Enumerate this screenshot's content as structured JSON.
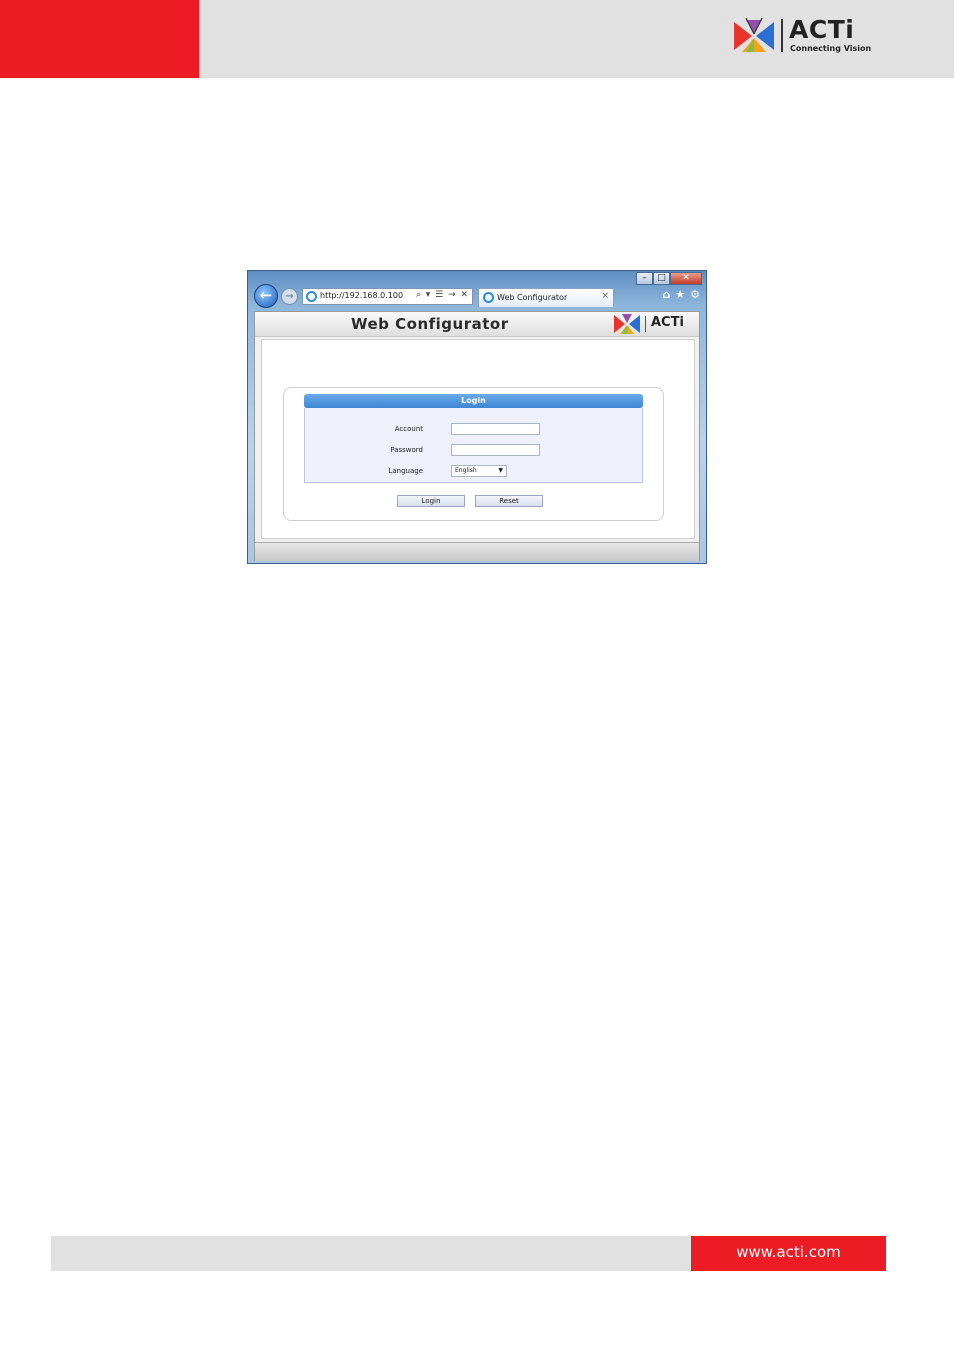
{
  "header": {
    "brand_name": "ACTi",
    "brand_tagline": "Connecting Vision"
  },
  "browser": {
    "address_url": "http://192.168.0.100",
    "address_tools": "⌕ ▾ ☰ → ✕",
    "tab_title": "Web Configurator",
    "tab_close": "×",
    "window_controls": {
      "minimize": "–",
      "maximize": "□",
      "close": "✕"
    },
    "toolbar_icons": [
      "home-icon",
      "favorites-star-icon",
      "settings-gear-icon"
    ]
  },
  "web_configurator": {
    "title": "Web Configurator",
    "brand": "ACTi",
    "login": {
      "heading": "Login",
      "account_label": "Account",
      "account_value": "",
      "password_label": "Password",
      "password_value": "",
      "language_label": "Language",
      "language_selected": "English",
      "login_button": "Login",
      "reset_button": "Reset"
    }
  },
  "footer": {
    "url": "www.acti.com"
  },
  "colors": {
    "brand_red": "#ed1c24",
    "header_gray": "#e1e1e1",
    "login_blue": "#3d86d3"
  }
}
